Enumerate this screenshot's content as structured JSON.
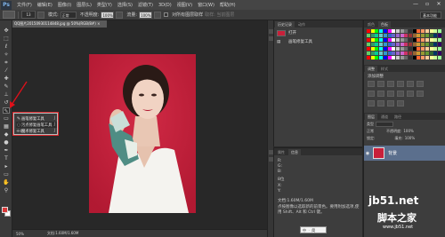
{
  "app": {
    "logo": "Ps"
  },
  "menu": [
    "文件(F)",
    "编辑(E)",
    "图像(I)",
    "图层(L)",
    "类型(Y)",
    "选择(S)",
    "滤镜(T)",
    "3D(D)",
    "视图(V)",
    "窗口(W)",
    "帮助(H)"
  ],
  "window_controls": {
    "minimize": "—",
    "restore": "▫",
    "close": "✕"
  },
  "options": {
    "brush_size": "13",
    "mode_label": "模式:",
    "mode_value": "正常",
    "opacity_label": "不透明度:",
    "opacity_value": "100%",
    "flow_label": "流量:",
    "flow_value": "100%",
    "sample_label": "对所有图层取样",
    "sample_dim": "取样: 当前图层",
    "workspace": "基本功能"
  },
  "document": {
    "tab_title": "QQ图片20150930114848.jpg @ 50%(RGB/8#) ×",
    "zoom": "50%",
    "doc_size": "文档:1.60M/1.60M"
  },
  "flyout": {
    "items": [
      {
        "icon": "brush-tool-icon",
        "glyph": "✎",
        "label": "画笔修复工具",
        "key": "J"
      },
      {
        "icon": "patch-tool-icon",
        "glyph": "◌",
        "label": "污点修复画笔工具",
        "key": "J"
      },
      {
        "icon": "redeye-tool-icon",
        "glyph": "+o",
        "label": "魔术修复工具",
        "key": "J"
      }
    ]
  },
  "history": {
    "tabs": [
      "历史记录",
      "动作"
    ],
    "rows": [
      "打开",
      "画笔修复工具"
    ]
  },
  "properties": {
    "tabs": [
      "属性",
      "信息"
    ],
    "rows": [
      "R:",
      "G:",
      "B:",
      "8位",
      "X:",
      "Y:",
      "文档:1.60M/1.60M",
      "点按图像以选取新的前景色。要用附加选项,使用 Shift、Alt 和 Ctrl 键。"
    ]
  },
  "ime": "中 ㆍ 简",
  "swatches": {
    "tabs": [
      "颜色",
      "色板"
    ],
    "colors": [
      "#ff0000",
      "#ffff00",
      "#00ff00",
      "#00ffff",
      "#0000ff",
      "#ff00ff",
      "#ffffff",
      "#cccccc",
      "#999999",
      "#666666",
      "#333333",
      "#000000",
      "#ff6633",
      "#ff9966",
      "#ffcc99",
      "#ffff99",
      "#ccff99",
      "#99ff99",
      "#66cc66",
      "#339966",
      "#00cc99",
      "#66cccc",
      "#3399cc",
      "#3366cc",
      "#6666cc",
      "#9966cc",
      "#cc66cc",
      "#cc3366",
      "#993333",
      "#996633",
      "#cc9933",
      "#999933",
      "#669933",
      "#336633",
      "#003366",
      "#330066"
    ]
  },
  "adjustments": {
    "tabs": [
      "调整",
      "样式"
    ],
    "heading": "添加调整"
  },
  "layers": {
    "tabs": [
      "图层",
      "通道",
      "路径"
    ],
    "filter_label": "类型",
    "blend": "正常",
    "opacity_label": "不透明度:",
    "opacity": "100%",
    "lock_label": "锁定:",
    "fill_label": "填充:",
    "fill": "100%",
    "layer_name": "背景"
  },
  "watermark": {
    "brand": "jb51.net",
    "name": "脚本之家",
    "url": "www.jb51.net"
  }
}
